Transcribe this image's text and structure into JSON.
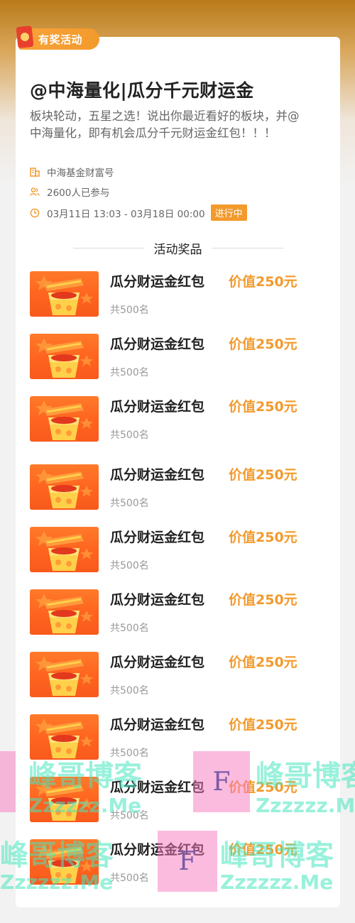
{
  "tag": {
    "label": "有奖活动"
  },
  "activity": {
    "title": "@中海量化|瓜分千元财运金",
    "description": "板块轮动，五星之选！说出你最近看好的板块，并@中海量化，即有机会瓜分千元财运金红包！！！",
    "organizer": "中海基金财富号",
    "participants": "2600人已参与",
    "time_range": "03月11日 13:03 - 03月18日 00:00",
    "status": "进行中"
  },
  "prizes_section": {
    "heading": "活动奖品"
  },
  "prizes": [
    {
      "name": "瓜分财运金红包",
      "value": "价值250元",
      "count": "共500名"
    },
    {
      "name": "瓜分财运金红包",
      "value": "价值250元",
      "count": "共500名"
    },
    {
      "name": "瓜分财运金红包",
      "value": "价值250元",
      "count": "共500名"
    },
    {
      "name": "瓜分财运金红包",
      "value": "价值250元",
      "count": "共500名"
    },
    {
      "name": "瓜分财运金红包",
      "value": "价值250元",
      "count": "共500名"
    },
    {
      "name": "瓜分财运金红包",
      "value": "价值250元",
      "count": "共500名"
    },
    {
      "name": "瓜分财运金红包",
      "value": "价值250元",
      "count": "共500名"
    },
    {
      "name": "瓜分财运金红包",
      "value": "价值250元",
      "count": "共500名"
    },
    {
      "name": "瓜分财运金红包",
      "value": "价值250元",
      "count": "共500名"
    },
    {
      "name": "瓜分财运金红包",
      "value": "价值250元",
      "count": "共500名"
    }
  ],
  "watermark": {
    "text_cn": "峰哥博客",
    "text_url": "Zzzzzz.Me",
    "box_letter": "F"
  },
  "colors": {
    "accent": "#f39a2c",
    "title": "#222222",
    "muted": "#999999"
  }
}
